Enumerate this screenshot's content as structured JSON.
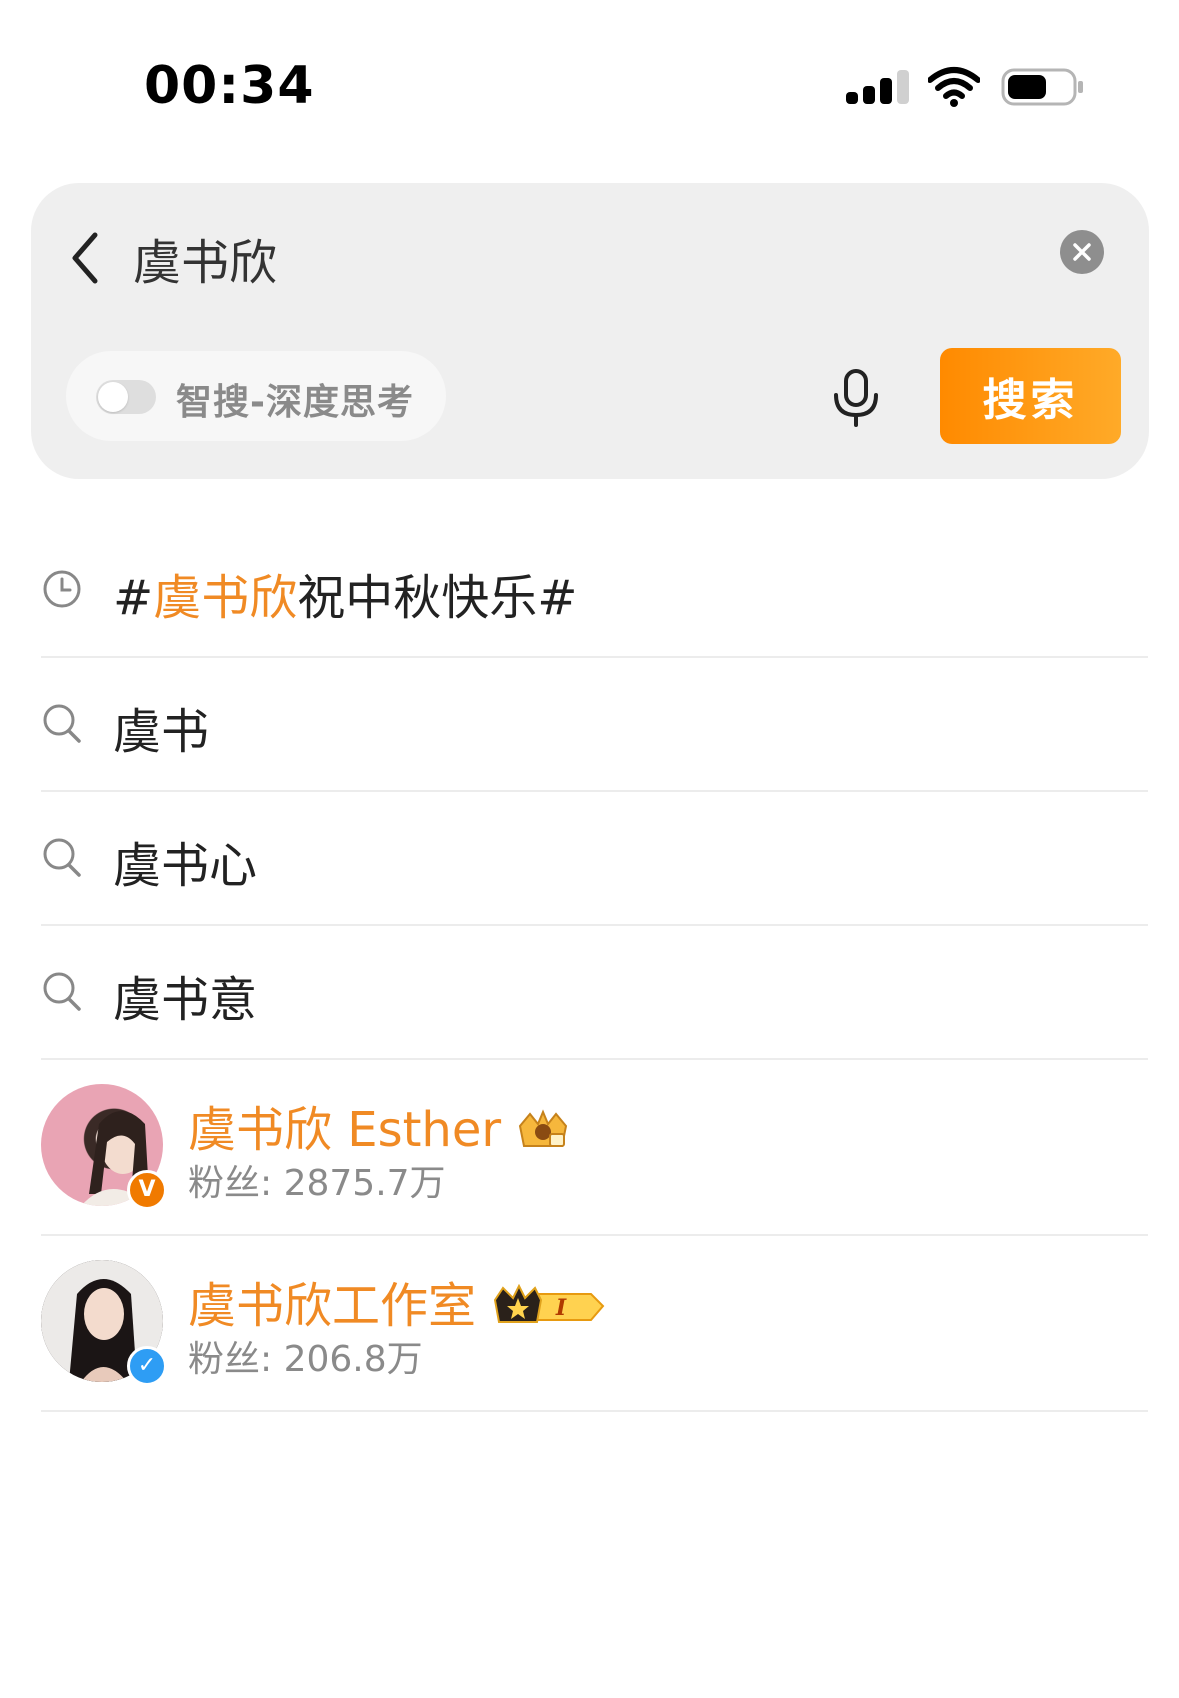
{
  "status_bar": {
    "time": "00:34"
  },
  "search": {
    "query": "虞书欣",
    "smart_search_label": "智搜-深度思考",
    "smart_search_enabled": false,
    "search_button_label": "搜索"
  },
  "suggestions": [
    {
      "type": "history",
      "icon": "clock-icon",
      "prefix": "#",
      "highlight": "虞书欣",
      "suffix": "祝中秋快乐#"
    },
    {
      "type": "search",
      "icon": "search-icon",
      "text": "虞书"
    },
    {
      "type": "search",
      "icon": "search-icon",
      "text": "虞书心"
    },
    {
      "type": "search",
      "icon": "search-icon",
      "text": "虞书意"
    }
  ],
  "users": [
    {
      "name": "虞书欣 Esther",
      "fans": "粉丝: 2875.7万",
      "verified": "orange-v",
      "badge_icon": "crown-gold-icon"
    },
    {
      "name": "虞书欣工作室",
      "fans": "粉丝: 206.8万",
      "verified": "blue-v",
      "badge_icon": "crown-level-icon",
      "badge_level": "I"
    }
  ],
  "colors": {
    "accent": "#f08a24",
    "search_button_start": "#ff8a00",
    "search_button_end": "#ffaa28",
    "card_bg": "#efefef"
  }
}
